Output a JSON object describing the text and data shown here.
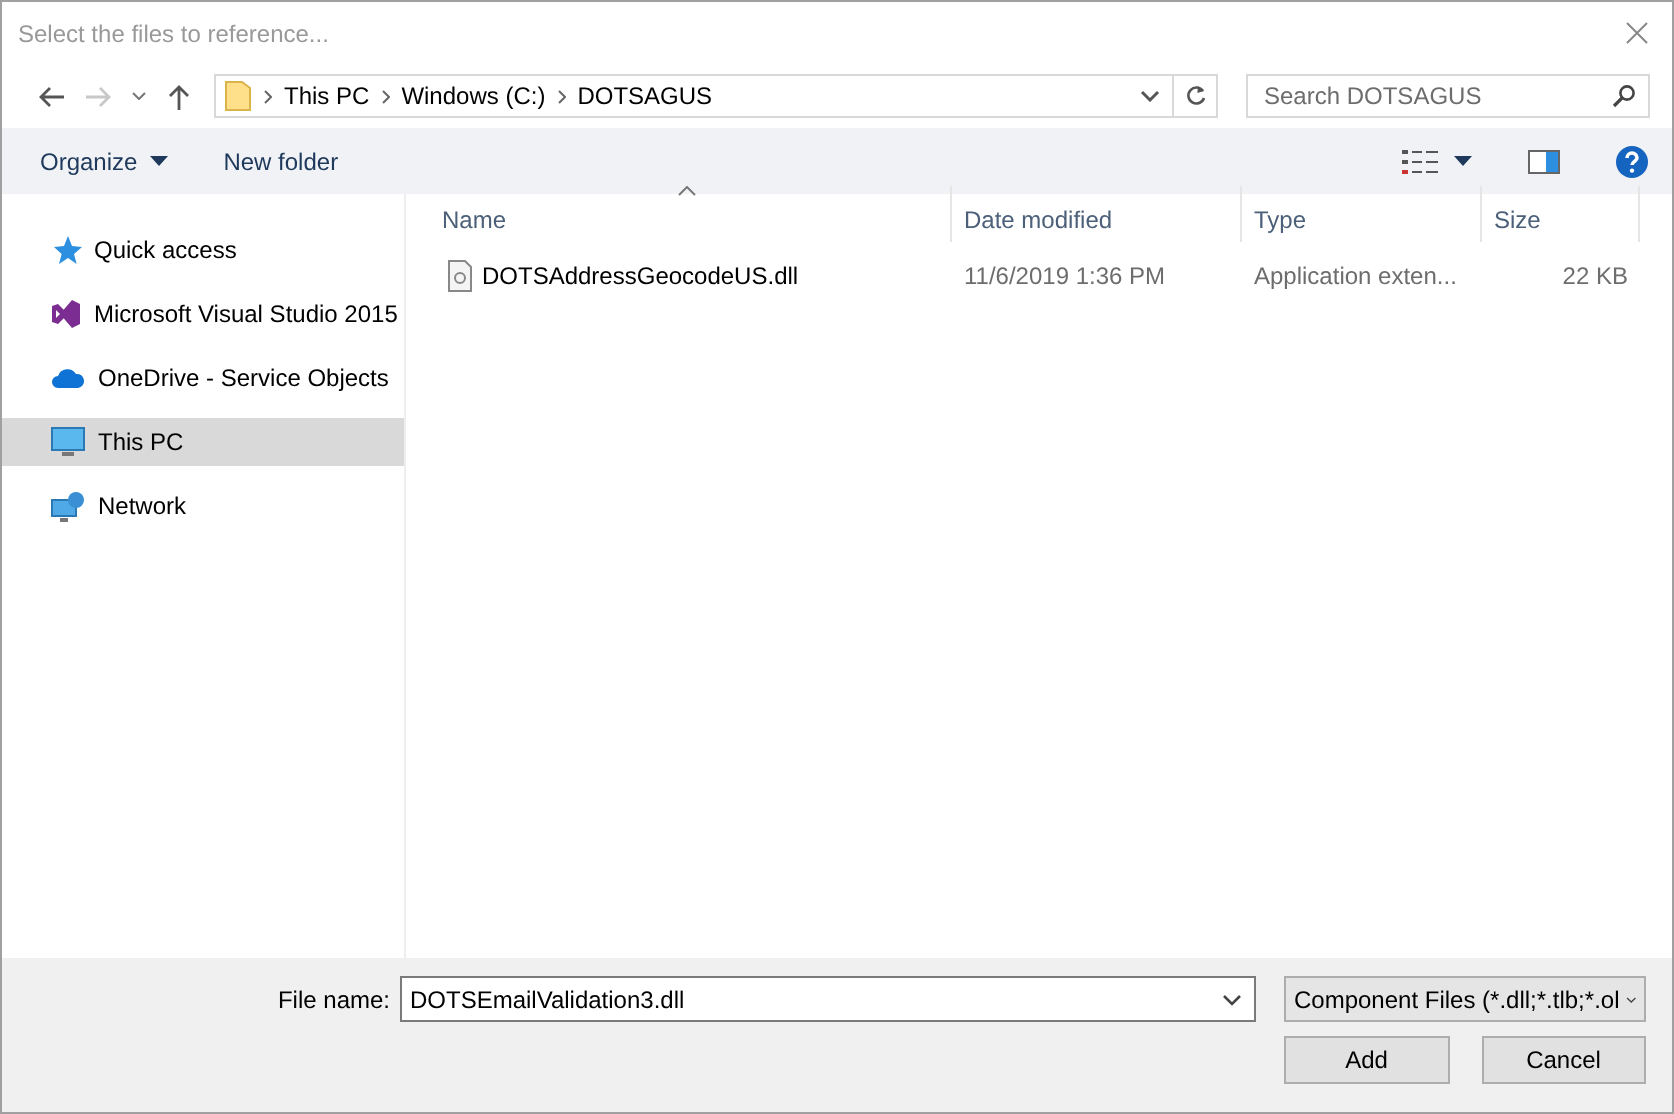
{
  "window": {
    "title": "Select the files to reference..."
  },
  "address": {
    "crumbs": [
      "This PC",
      "Windows (C:)",
      "DOTSAGUS"
    ]
  },
  "search": {
    "placeholder": "Search DOTSAGUS"
  },
  "toolbar": {
    "organize": "Organize",
    "new_folder": "New folder"
  },
  "sidebar": {
    "items": [
      {
        "label": "Quick access",
        "kind": "star",
        "selected": false
      },
      {
        "label": "Microsoft Visual Studio 2015",
        "kind": "vs",
        "selected": false
      },
      {
        "label": "OneDrive - Service Objects",
        "kind": "cloud",
        "selected": false
      },
      {
        "label": "This PC",
        "kind": "pc",
        "selected": true
      },
      {
        "label": "Network",
        "kind": "network",
        "selected": false
      }
    ]
  },
  "table": {
    "columns": [
      {
        "label": "Name",
        "sorted": true
      },
      {
        "label": "Date modified",
        "sorted": false
      },
      {
        "label": "Type",
        "sorted": false
      },
      {
        "label": "Size",
        "sorted": false
      }
    ],
    "rows": [
      {
        "name": "DOTSAddressGeocodeUS.dll",
        "date": "11/6/2019 1:36 PM",
        "type": "Application exten...",
        "size": "22 KB"
      }
    ]
  },
  "footer": {
    "file_name_label": "File name:",
    "file_name": "DOTSEmailValidation3.dll",
    "filter": "Component Files (*.dll;*.tlb;*.ol",
    "buttons": [
      "Add",
      "Cancel"
    ]
  }
}
